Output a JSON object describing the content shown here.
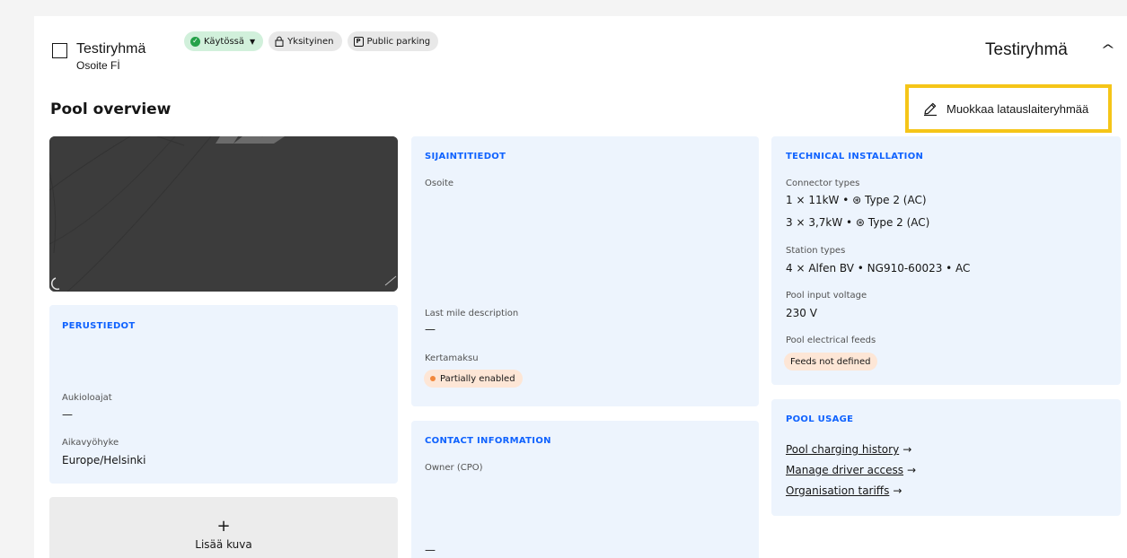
{
  "header": {
    "group_name": "Testiryhmä",
    "address": "Osoite Fİ",
    "status_tag": "Käytössä",
    "privacy_tag": "Yksityinen",
    "parking_tag": "Public parking",
    "right_title": "Testiryhmä"
  },
  "pool": {
    "title": "Pool overview",
    "edit_label": "Muokkaa latauslaiteryhmää"
  },
  "basic": {
    "heading": "PERUSTIEDOT",
    "opening_label": "Aukioloajat",
    "opening_value": "—",
    "timezone_label": "Aikavyöhyke",
    "timezone_value": "Europe/Helsinki"
  },
  "add_image": {
    "plus": "+",
    "label": "Lisää kuva"
  },
  "location": {
    "heading": "SIJAINTITIEDOT",
    "address_label": "Osoite",
    "last_mile_label": "Last mile description",
    "last_mile_value": "—",
    "single_payment_label": "Kertamaksu",
    "single_payment_value": "Partially enabled"
  },
  "contact": {
    "heading": "CONTACT INFORMATION",
    "owner_label": "Owner (CPO)",
    "owner_value": "—"
  },
  "technical": {
    "heading": "TECHNICAL INSTALLATION",
    "connector_label": "Connector types",
    "connector_1": "1 × 11kW • ⊛ Type 2 (AC)",
    "connector_2": "3 × 3,7kW • ⊛ Type 2 (AC)",
    "station_label": "Station types",
    "station_value": "4 × Alfen BV • NG910-60023 • AC",
    "voltage_label": "Pool input voltage",
    "voltage_value": "230 V",
    "feeds_label": "Pool electrical feeds",
    "feeds_value": "Feeds not defined"
  },
  "usage": {
    "heading": "POOL USAGE",
    "link_history": "Pool charging history",
    "link_access": "Manage driver access",
    "link_tariffs": "Organisation tariffs",
    "arrow": "→"
  },
  "colors": {
    "accent_blue": "#0f62fe",
    "card_bg": "#edf4fd",
    "highlight": "#f5c518",
    "status_green": "#24a148",
    "partial_orange": "#f1883c"
  }
}
